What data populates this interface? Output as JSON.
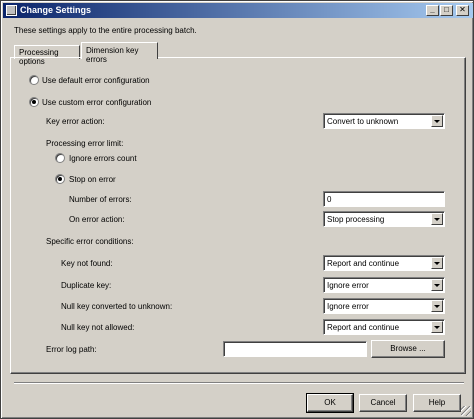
{
  "window": {
    "title": "Change Settings",
    "min_glyph": "_",
    "max_glyph": "□",
    "close_glyph": "✕"
  },
  "header": {
    "description": "These settings apply to the entire processing batch."
  },
  "tabs": [
    {
      "label": "Processing options",
      "active": false
    },
    {
      "label": "Dimension key errors",
      "active": true
    }
  ],
  "config": {
    "default_label": "Use default error configuration",
    "custom_label": "Use custom error configuration",
    "selected": "custom"
  },
  "key_error_action": {
    "label": "Key error action:",
    "value": "Convert to unknown"
  },
  "processing_error_limit": {
    "label": "Processing error limit:",
    "ignore_label": "Ignore errors count",
    "stop_label": "Stop on error",
    "selected": "stop",
    "number_label": "Number of errors:",
    "number_value": "0",
    "on_error_label": "On error action:",
    "on_error_value": "Stop processing"
  },
  "specific_conditions": {
    "label": "Specific error conditions:",
    "rows": [
      {
        "label": "Key not found:",
        "value": "Report and continue"
      },
      {
        "label": "Duplicate key:",
        "value": "Ignore error"
      },
      {
        "label": "Null key converted to unknown:",
        "value": "Ignore error"
      },
      {
        "label": "Null key not allowed:",
        "value": "Report and continue"
      }
    ]
  },
  "error_log": {
    "label": "Error log path:",
    "value": "",
    "browse_label": "Browse ..."
  },
  "footer": {
    "ok_label": "OK",
    "cancel_label": "Cancel",
    "help_label": "Help"
  }
}
